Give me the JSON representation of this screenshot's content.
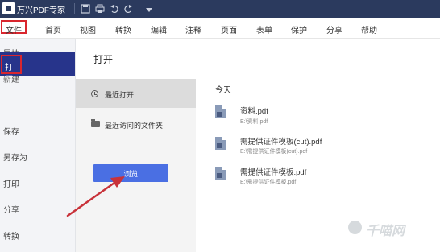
{
  "titlebar": {
    "app_title": "万兴PDF专家",
    "icons": [
      "logo-icon",
      "save-icon",
      "print-icon",
      "undo-icon",
      "redo-icon",
      "dropdown-icon"
    ]
  },
  "menu": {
    "items": [
      "文件",
      "首页",
      "视图",
      "转换",
      "编辑",
      "注释",
      "页面",
      "表单",
      "保护",
      "分享",
      "帮助"
    ]
  },
  "sidebar": {
    "items": [
      "属性",
      "新建",
      "打开",
      "保存",
      "另存为",
      "打印",
      "分享",
      "转换"
    ],
    "active": "打开"
  },
  "main": {
    "title": "打开",
    "recent_label": "最近打开",
    "recent_folder_label": "最近访问的文件夹",
    "browse_label": "浏览",
    "today_label": "今天",
    "files": [
      {
        "name": "资料.pdf",
        "path": "E:\\资料.pdf"
      },
      {
        "name": "需提供证件模板(cut).pdf",
        "path": "E:\\需提供证件模板(cut).pdf"
      },
      {
        "name": "需提供证件模板.pdf",
        "path": "E:\\需提供证件模板.pdf"
      }
    ]
  },
  "watermark": {
    "text": "千喵网"
  },
  "colors": {
    "titlebar": "#2b3a5e",
    "active_sidebar": "#27348b",
    "highlight_box": "#d9262e",
    "button": "#4a6fe3",
    "arrow": "#c8323a"
  }
}
